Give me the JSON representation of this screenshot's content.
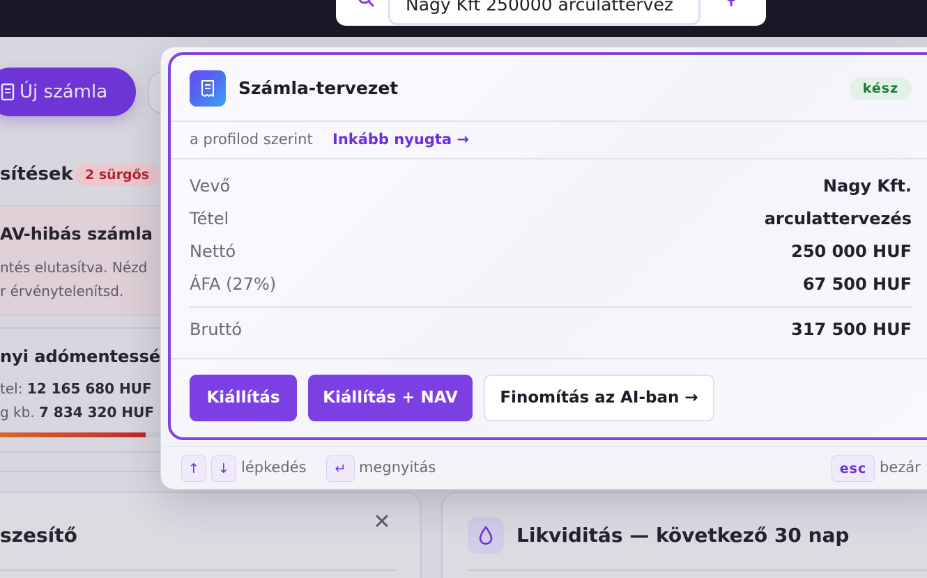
{
  "search": {
    "query": "Nagy Kft 250000 arculattervez"
  },
  "background": {
    "new_invoice_label": "Új számla",
    "notifications_title": "sítések",
    "urgent_badge": "2 sürgős",
    "nav_error_title": "AV-hibás számla",
    "nav_error_line1": "ntés elutasítva. Nézd",
    "nav_error_line2": "r érvénytelenítsd.",
    "tax_title": "nyi adómentesség",
    "tax_line1_prefix": "tel: ",
    "tax_line1_value": "12 165 680 HUF",
    "tax_line2_prefix": "g kb. ",
    "tax_line2_value": "7 834 320 HUF",
    "tax_progress_fraction": 0.87,
    "left_panel_title": "szesítő",
    "close_symbol": "✕",
    "right_panel_title": "Likviditás — következő 30 nap"
  },
  "draft": {
    "title": "Számla-tervezet",
    "status": "kész",
    "profile_note": "a profilod szerint",
    "receipt_link": "Inkább nyugta →",
    "rows": [
      {
        "label": "Vevő",
        "value": "Nagy Kft."
      },
      {
        "label": "Tétel",
        "value": "arculattervezés"
      },
      {
        "label": "Nettó",
        "value": "250 000 HUF"
      },
      {
        "label": "ÁFA (27%)",
        "value": "67 500 HUF"
      }
    ],
    "total_label": "Bruttó",
    "total_value": "317 500 HUF",
    "buttons": {
      "issue": "Kiállítás",
      "issue_nav": "Kiállítás + NAV",
      "refine": "Finomítás az AI-ban →"
    }
  },
  "footer": {
    "key_up": "↑",
    "key_down": "↓",
    "navigate_hint": "lépkedés",
    "key_enter": "↵",
    "open_hint": "megnyitás",
    "key_esc": "esc",
    "close_hint": "bezár"
  },
  "colors": {
    "accent": "#7b3fe4",
    "topbar": "#1b1828",
    "ready_badge_bg": "#e3f2e6",
    "urgent_badge_text": "#b3262d"
  },
  "icons": {
    "search": "search-icon",
    "mic": "mic-icon",
    "document": "receipt-icon",
    "droplet": "droplet-icon"
  }
}
